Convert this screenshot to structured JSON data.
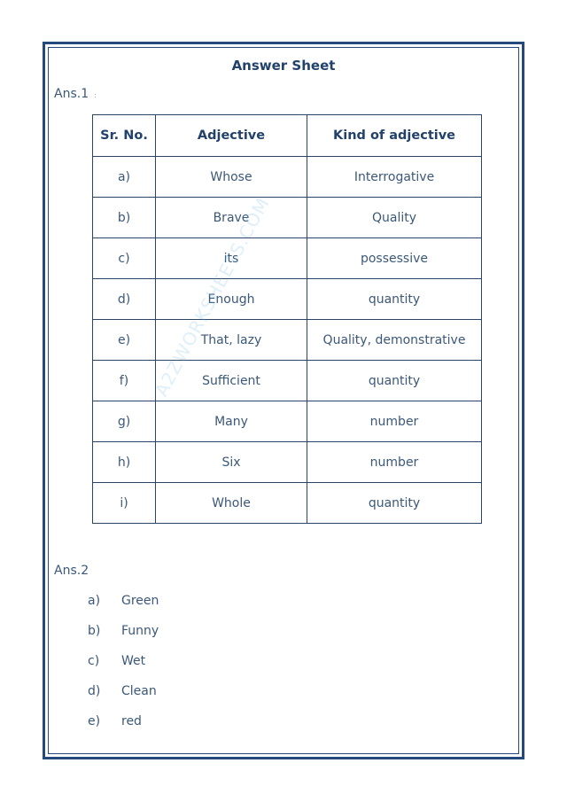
{
  "title": "Answer Sheet",
  "ans1": {
    "label": "Ans.1",
    "dot": ":",
    "headers": [
      "Sr. No.",
      "Adjective",
      "Kind of adjective"
    ],
    "rows": [
      {
        "sr": "a)",
        "adjective": "Whose",
        "kind": "Interrogative"
      },
      {
        "sr": "b)",
        "adjective": "Brave",
        "kind": "Quality"
      },
      {
        "sr": "c)",
        "adjective": "its",
        "kind": "possessive"
      },
      {
        "sr": "d)",
        "adjective": "Enough",
        "kind": "quantity"
      },
      {
        "sr": "e)",
        "adjective": "That, lazy",
        "kind": "Quality, demonstrative"
      },
      {
        "sr": "f)",
        "adjective": "Sufficient",
        "kind": "quantity"
      },
      {
        "sr": "g)",
        "adjective": "Many",
        "kind": "number"
      },
      {
        "sr": "h)",
        "adjective": "Six",
        "kind": "number"
      },
      {
        "sr": "i)",
        "adjective": "Whole",
        "kind": "quantity"
      }
    ]
  },
  "ans2": {
    "label": "Ans.2",
    "items": [
      {
        "key": "a)",
        "value": "Green"
      },
      {
        "key": "b)",
        "value": "Funny"
      },
      {
        "key": "c)",
        "value": "Wet"
      },
      {
        "key": "d)",
        "value": "Clean"
      },
      {
        "key": "e)",
        "value": "red"
      }
    ]
  },
  "watermark": "A2ZWORKSHEETS.COM",
  "colors": {
    "border": "#24497a",
    "heading": "#22416b",
    "text": "#3b5878"
  }
}
